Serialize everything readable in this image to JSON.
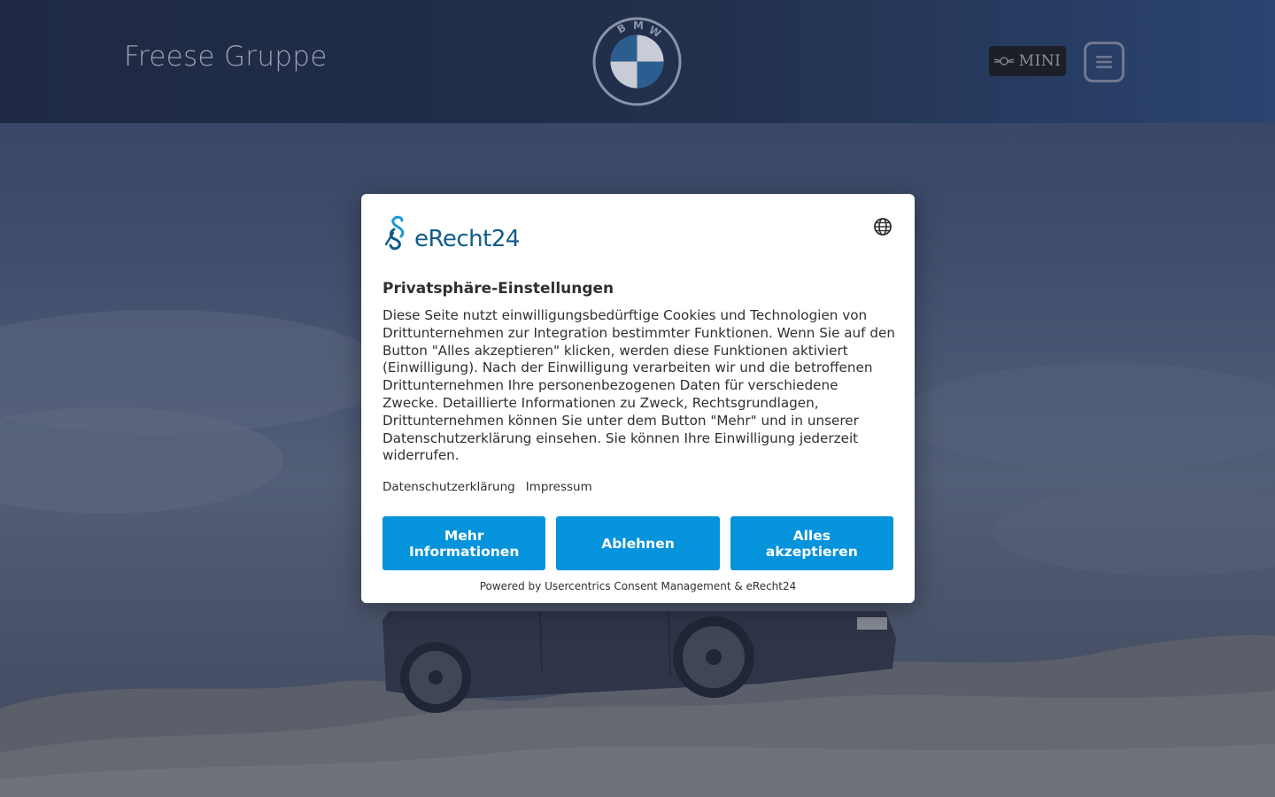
{
  "header": {
    "brand": "Freese Gruppe",
    "bmw_letters": [
      "B",
      "M",
      "W"
    ],
    "mini_label": "MINI"
  },
  "consent": {
    "logo_text": "eRecht24",
    "title": "Privatsphäre-Einstellungen",
    "body": "Diese Seite nutzt einwilligungsbedürftige Cookies und Technologien von Drittunternehmen zur Integration bestimmter Funktionen. Wenn Sie auf den Button \"Alles akzeptieren\" klicken, werden diese Funktionen aktiviert (Einwilligung). Nach der Einwilligung verarbeiten wir und die betroffenen Drittunternehmen Ihre personenbezogenen Daten für verschiedene Zwecke. Detaillierte Informationen zu Zweck, Rechtsgrundlagen, Drittunternehmen können Sie unter dem Button \"Mehr\" und in unserer Datenschutzerklärung einsehen. Sie können Ihre Einwilligung jederzeit widerrufen.",
    "links": {
      "privacy": "Datenschutzerklärung",
      "imprint": "Impressum"
    },
    "buttons": {
      "more": "Mehr Informationen",
      "deny": "Ablehnen",
      "accept": "Alles akzeptieren"
    },
    "powered_by": "Powered by Usercentrics Consent Management & eRecht24"
  },
  "colors": {
    "accent_button": "#0593dc",
    "logo_blue": "#0e5c8c",
    "header_bg": "#1f2943"
  }
}
